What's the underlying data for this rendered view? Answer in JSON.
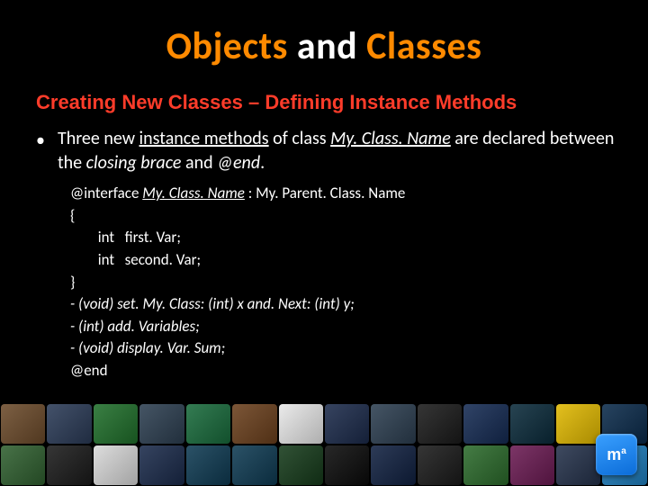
{
  "title": {
    "w1": "Objects",
    "w2": " and ",
    "w3": "Classes"
  },
  "subtitle": "Creating New Classes – Defining Instance Methods",
  "bullet": {
    "dot": "•",
    "p1": "Three new ",
    "p2": "instance methods",
    "p3": " of class ",
    "p4": "My. Class. Name",
    "p5": " are declared between the ",
    "p6": "closing brace",
    "p7": " and ",
    "p8": "@end",
    "p9": "."
  },
  "code": {
    "l1a": "@interface ",
    "l1b": "My. Class. Name",
    "l1c": " : My. Parent. Class. Name",
    "l2": "{",
    "l3": "        int   first. Var;",
    "l4": "        int   second. Var;",
    "l5": "}",
    "l6": "- (void) set. My. Class: (int) x and. Next: (int) y;",
    "l7": "- (int) add. Variables;",
    "l8": "- (void) display. Var. Sum;",
    "l9": "@end"
  },
  "badge": {
    "m": "m",
    "sup": "a"
  },
  "dock": {
    "row1": [
      "#6b4a2a",
      "#2a3a56",
      "#1f6e2a",
      "#2c3e50",
      "#186a3b",
      "#6a3f1c",
      "#e8e8e8",
      "#1b2a4a",
      "#2c3e50",
      "#1a1a1a",
      "#142a52",
      "#0a2a3a",
      "#e0b800",
      "#0a2a4a"
    ],
    "row2": [
      "#2f5f2f",
      "#1a1a1a",
      "#d8d8d8",
      "#1a2a4a",
      "#0e3a52",
      "#0e3a52",
      "#153a1a",
      "#0a0a0a",
      "#102040",
      "#1a1a1a",
      "#2b6a2b",
      "#6a1a52",
      "#24314a",
      "#1f7fbf"
    ]
  }
}
